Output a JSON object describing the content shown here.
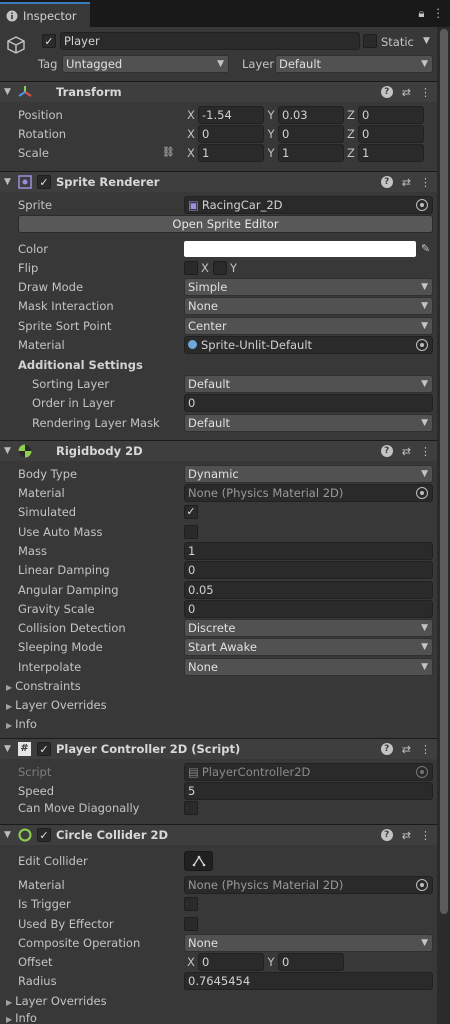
{
  "tab": {
    "title": "Inspector"
  },
  "gameobject": {
    "name": "Player",
    "static_label": "Static",
    "tag_label": "Tag",
    "tag_value": "Untagged",
    "layer_label": "Layer",
    "layer_value": "Default"
  },
  "transform": {
    "title": "Transform",
    "position_label": "Position",
    "position": {
      "x": "-1.54",
      "y": "0.03",
      "z": "0"
    },
    "rotation_label": "Rotation",
    "rotation": {
      "x": "0",
      "y": "0",
      "z": "0"
    },
    "scale_label": "Scale",
    "scale": {
      "x": "1",
      "y": "1",
      "z": "1"
    }
  },
  "sprite_renderer": {
    "title": "Sprite Renderer",
    "sprite_label": "Sprite",
    "sprite_value": "RacingCar_2D",
    "open_editor": "Open Sprite Editor",
    "color_label": "Color",
    "flip_label": "Flip",
    "flip_x": "X",
    "flip_y": "Y",
    "draw_mode_label": "Draw Mode",
    "draw_mode": "Simple",
    "mask_label": "Mask Interaction",
    "mask": "None",
    "sort_point_label": "Sprite Sort Point",
    "sort_point": "Center",
    "material_label": "Material",
    "material": "Sprite-Unlit-Default",
    "additional_label": "Additional Settings",
    "sorting_layer_label": "Sorting Layer",
    "sorting_layer": "Default",
    "order_label": "Order in Layer",
    "order": "0",
    "rendering_mask_label": "Rendering Layer Mask",
    "rendering_mask": "Default"
  },
  "rigidbody": {
    "title": "Rigidbody 2D",
    "body_type_label": "Body Type",
    "body_type": "Dynamic",
    "material_label": "Material",
    "material": "None (Physics Material 2D)",
    "simulated_label": "Simulated",
    "auto_mass_label": "Use Auto Mass",
    "mass_label": "Mass",
    "mass": "1",
    "linear_label": "Linear Damping",
    "linear": "0",
    "angular_label": "Angular Damping",
    "angular": "0.05",
    "gravity_label": "Gravity Scale",
    "gravity": "0",
    "collision_label": "Collision Detection",
    "collision": "Discrete",
    "sleeping_label": "Sleeping Mode",
    "sleeping": "Start Awake",
    "interpolate_label": "Interpolate",
    "interpolate": "None",
    "constraints_label": "Constraints",
    "overrides_label": "Layer Overrides",
    "info_label": "Info"
  },
  "player_controller": {
    "title": "Player Controller 2D (Script)",
    "script_label": "Script",
    "script_value": "PlayerController2D",
    "speed_label": "Speed",
    "speed": "5",
    "diag_label": "Can Move Diagonally"
  },
  "circle_collider": {
    "title": "Circle Collider 2D",
    "edit_label": "Edit Collider",
    "material_label": "Material",
    "material": "None (Physics Material 2D)",
    "trigger_label": "Is Trigger",
    "effector_label": "Used By Effector",
    "composite_label": "Composite Operation",
    "composite": "None",
    "offset_label": "Offset",
    "offset": {
      "x": "0",
      "y": "0"
    },
    "radius_label": "Radius",
    "radius": "0.7645454",
    "overrides_label": "Layer Overrides",
    "info_label": "Info"
  },
  "colors": {
    "accent": "#3a79bb",
    "background": "#383838",
    "header": "#3e3e3e",
    "field": "#2a2a2a"
  }
}
